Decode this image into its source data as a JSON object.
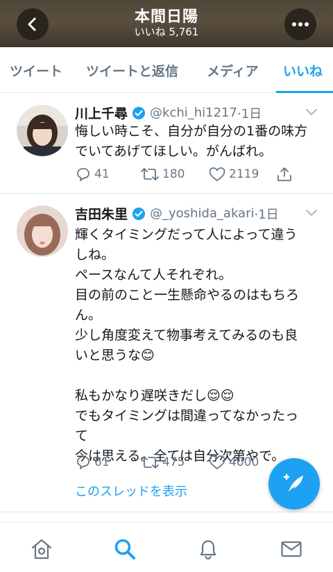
{
  "header": {
    "title": "本間日陽",
    "subtitle": "いいね 5,761",
    "back_icon": "chevron-left-icon",
    "more_icon": "more-dots-icon"
  },
  "tabs": [
    {
      "label": "ツイート",
      "active": false
    },
    {
      "label": "ツイートと返信",
      "active": false
    },
    {
      "label": "メディア",
      "active": false
    },
    {
      "label": "いいね",
      "active": true
    }
  ],
  "tweets": [
    {
      "name": "川上千尋",
      "verified": true,
      "handle": "@kchi_hi1217",
      "time": "·1日",
      "text": "悔しい時こそ、自分が自分の1番の味方\nでいてあげてほしい。がんばれ。",
      "replies": "41",
      "retweets": "180",
      "likes": "2119"
    },
    {
      "name": "吉田朱里",
      "verified": true,
      "handle": "@_yoshida_akari",
      "time": "·1日",
      "text": "輝くタイミングだって人によって違う\nしね。\nペースなんて人それぞれ。\n目の前のこと一生懸命やるのはもちろ\nん。\n少し角度変えて物事考えてみるのも良\nいと思うな😊\n\n私もかなり遅咲きだし😌😌\nでもタイミングは間違ってなかったっ\nて\n今は思える。全ては自分次第やで。",
      "replies": "61",
      "retweets": "475",
      "likes": "4000",
      "thread_link": "このスレッドを表示"
    }
  ],
  "colors": {
    "accent": "#1da1f2",
    "muted": "#657786",
    "text": "#14171a"
  },
  "bottom_nav": [
    "home-icon",
    "search-icon",
    "notifications-icon",
    "messages-icon"
  ],
  "fab": {
    "icon": "compose-tweet-icon"
  }
}
